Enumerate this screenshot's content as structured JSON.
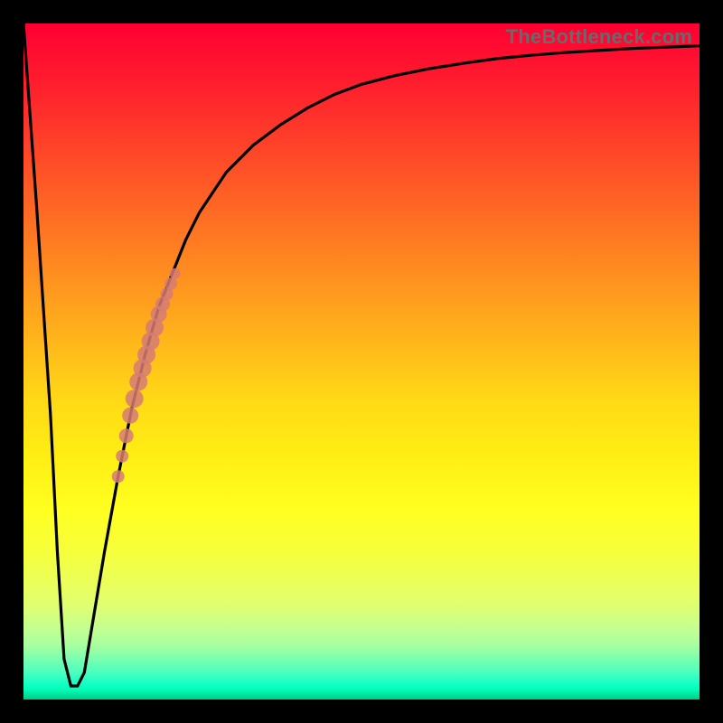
{
  "watermark": "TheBottleneck.com",
  "colors": {
    "frame": "#000000",
    "curve": "#000000",
    "dot": "#d67b74"
  },
  "chart_data": {
    "type": "line",
    "title": "",
    "xlabel": "",
    "ylabel": "",
    "xlim": [
      0,
      100
    ],
    "ylim": [
      0,
      100
    ],
    "grid": false,
    "legend": false,
    "series": [
      {
        "name": "bottleneck-curve",
        "x": [
          0,
          2,
          4,
          5,
          6,
          7,
          8,
          9,
          10,
          12,
          14,
          16,
          18,
          20,
          22,
          24,
          26,
          28,
          30,
          34,
          38,
          42,
          46,
          50,
          55,
          60,
          65,
          70,
          75,
          80,
          85,
          90,
          95,
          100
        ],
        "y": [
          100,
          72,
          42,
          22,
          6,
          2,
          2,
          4,
          10,
          22,
          33,
          43,
          51,
          58,
          63,
          68,
          72,
          75,
          78,
          82,
          85,
          87.5,
          89.5,
          91,
          92.3,
          93.3,
          94.1,
          94.8,
          95.3,
          95.7,
          96.0,
          96.3,
          96.5,
          96.7
        ]
      }
    ],
    "highlight_points": {
      "name": "marked-range",
      "x": [
        14.0,
        14.6,
        15.2,
        15.8,
        16.4,
        17.0,
        17.6,
        18.2,
        18.8,
        19.4,
        20.0,
        20.6,
        21.2,
        21.8,
        22.4
      ],
      "y": [
        33.0,
        36.0,
        39.0,
        42.0,
        44.5,
        47.0,
        49.0,
        51.0,
        53.0,
        55.0,
        57.0,
        58.5,
        60.0,
        61.5,
        63.0
      ],
      "r": [
        7,
        7,
        8,
        9,
        10,
        10,
        10,
        10,
        10,
        10,
        9,
        8,
        7,
        7,
        6
      ]
    }
  }
}
